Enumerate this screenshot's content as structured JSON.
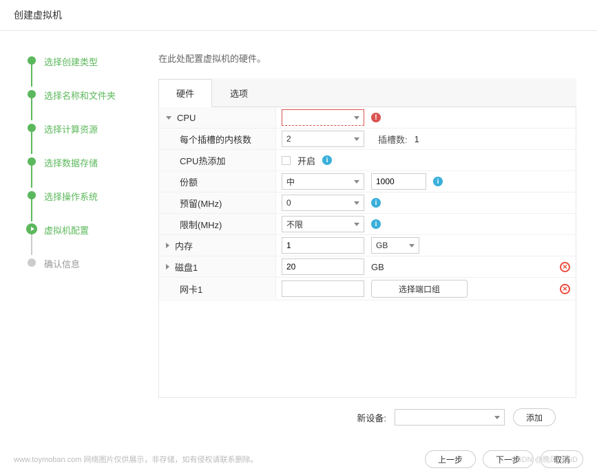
{
  "header": {
    "title": "创建虚拟机"
  },
  "wizard": {
    "steps": [
      {
        "label": "选择创建类型"
      },
      {
        "label": "选择名称和文件夹"
      },
      {
        "label": "选择计算资源"
      },
      {
        "label": "选择数据存储"
      },
      {
        "label": "选择操作系统"
      },
      {
        "label": "虚拟机配置"
      },
      {
        "label": "确认信息"
      }
    ]
  },
  "content": {
    "description": "在此处配置虚拟机的硬件。",
    "tabs": {
      "hardware": "硬件",
      "options": "选项"
    },
    "rows": {
      "cpu": {
        "label": "CPU",
        "value": ""
      },
      "cores": {
        "label": "每个插槽的内核数",
        "value": "2",
        "extra_label": "插槽数:",
        "extra_value": "1"
      },
      "hotadd": {
        "label": "CPU热添加",
        "checkbox_label": "开启"
      },
      "share": {
        "label": "份额",
        "value": "中",
        "numeric": "1000"
      },
      "reserve": {
        "label": "预留(MHz)",
        "value": "0"
      },
      "limit": {
        "label": "限制(MHz)",
        "value": "不限"
      },
      "memory": {
        "label": "内存",
        "value": "1",
        "unit": "GB"
      },
      "disk1": {
        "label": "磁盘1",
        "value": "20",
        "unit": "GB"
      },
      "nic1": {
        "label": "网卡1",
        "value": "",
        "button": "选择端口组"
      }
    },
    "new_device": {
      "label": "新设备:",
      "add": "添加"
    }
  },
  "footer": {
    "prev": "上一步",
    "next": "下一步",
    "cancel": "取消",
    "watermark_left": "www.toymoban.com  网络图片仅供展示，非存储，如有侵权请联系删除。",
    "watermark_right": "CSDN @晚风_END"
  }
}
